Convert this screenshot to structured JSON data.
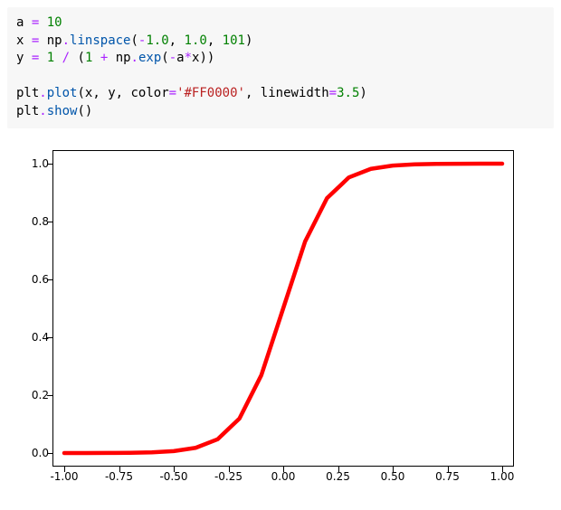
{
  "code": {
    "line1": {
      "var_a": "a",
      "eq": "=",
      "val": "10"
    },
    "line2": {
      "var_x": "x",
      "eq": "=",
      "mod": "np",
      "dot": ".",
      "fn": "linspace",
      "lp": "(",
      "a1": "-1.0",
      "c1": ", ",
      "a2": "1.0",
      "c2": ", ",
      "a3": "101",
      "rp": ")"
    },
    "line3": {
      "var_y": "y",
      "eq": "=",
      "n1": "1",
      "div": "/",
      "lp": "(",
      "n2": "1",
      "plus": "+",
      "mod": "np",
      "dot": ".",
      "fn": "exp",
      "lp2": "(",
      "neg": "-",
      "va": "a",
      "mul": "*",
      "vx": "x",
      "rp2": ")",
      "rp": ")"
    },
    "line5": {
      "mod": "plt",
      "dot": ".",
      "fn": "plot",
      "lp": "(",
      "ax": "x",
      "c1": ", ",
      "ay": "y",
      "c2": ", ",
      "kw1": "color",
      "eq1": "=",
      "s1": "'#FF0000'",
      "c3": ", ",
      "kw2": "linewidth",
      "eq2": "=",
      "v2": "3.5",
      "rp": ")"
    },
    "line6": {
      "mod": "plt",
      "dot": ".",
      "fn": "show",
      "lp": "(",
      "rp": ")"
    }
  },
  "chart_data": {
    "type": "line",
    "x": [
      -1.0,
      -0.9,
      -0.8,
      -0.7,
      -0.6,
      -0.5,
      -0.4,
      -0.3,
      -0.2,
      -0.1,
      0.0,
      0.1,
      0.2,
      0.3,
      0.4,
      0.5,
      0.6,
      0.7,
      0.8,
      0.9,
      1.0
    ],
    "y": [
      0.0,
      0.0001,
      0.0003,
      0.0009,
      0.0025,
      0.0067,
      0.018,
      0.0474,
      0.1192,
      0.2689,
      0.5,
      0.7311,
      0.8808,
      0.9526,
      0.982,
      0.9933,
      0.9975,
      0.9991,
      0.9997,
      0.9999,
      1.0
    ],
    "line_color": "#FF0000",
    "linewidth": 3.5,
    "xlim": [
      -1.0,
      1.0
    ],
    "ylim": [
      0.0,
      1.0
    ],
    "xticks": [
      -1.0,
      -0.75,
      -0.5,
      -0.25,
      0.0,
      0.25,
      0.5,
      0.75,
      1.0
    ],
    "yticks": [
      0.0,
      0.2,
      0.4,
      0.6,
      0.8,
      1.0
    ],
    "xtick_labels": [
      "-1.00",
      "-0.75",
      "-0.50",
      "-0.25",
      "0.00",
      "0.25",
      "0.50",
      "0.75",
      "1.00"
    ],
    "ytick_labels": [
      "0.0",
      "0.2",
      "0.4",
      "0.6",
      "0.8",
      "1.0"
    ],
    "title": "",
    "xlabel": "",
    "ylabel": ""
  }
}
